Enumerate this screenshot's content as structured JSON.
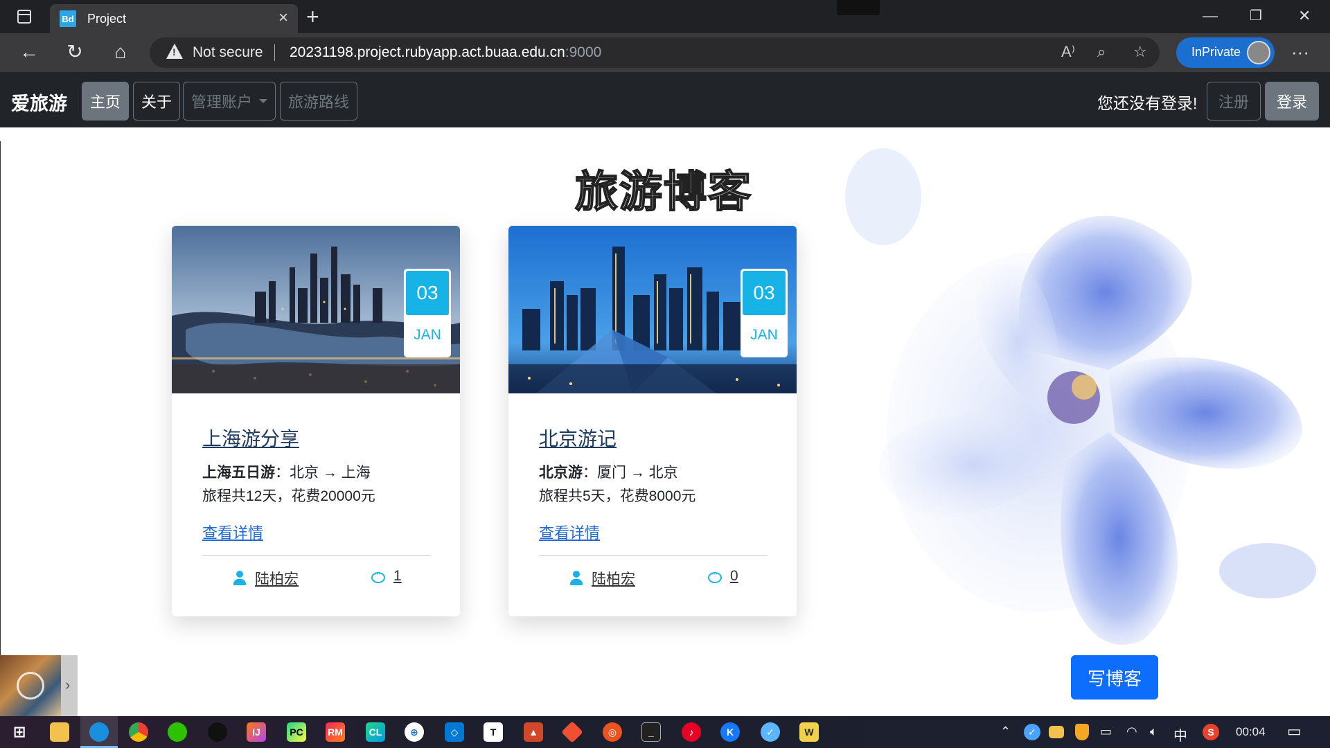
{
  "browser": {
    "tab_title": "Project",
    "tab_favicon": "Bd",
    "security_label": "Not secure",
    "url_host": "20231198.project.rubyapp.act.buaa.edu.cn",
    "url_port": ":9000",
    "inprivate_label": "InPrivate"
  },
  "navbar": {
    "brand": "爱旅游",
    "items": [
      {
        "label": "主页"
      },
      {
        "label": "关于"
      },
      {
        "label": "管理账户"
      },
      {
        "label": "旅游路线"
      }
    ],
    "login_message": "您还没有登录!",
    "register_label": "注册",
    "login_label": "登录"
  },
  "main": {
    "title": "旅游博客",
    "write_button": "写博客",
    "cards": [
      {
        "day": "03",
        "month": "JAN",
        "title": "上海游分享",
        "route_name": "上海五日游",
        "route_path": "北京 → 上海",
        "summary": "旅程共12天，花费20000元",
        "detail_link": "查看详情",
        "author": "陆柏宏",
        "comments": "1"
      },
      {
        "day": "03",
        "month": "JAN",
        "title": "北京游记",
        "route_name": "北京游",
        "route_path": "厦门 → 北京",
        "summary": "旅程共5天，花费8000元",
        "detail_link": "查看详情",
        "author": "陆柏宏",
        "comments": "0"
      }
    ]
  },
  "taskbar": {
    "clock": "00:04",
    "ime": "中"
  },
  "colors": {
    "accent": "#17b3e6",
    "primary_button": "#0d6efd",
    "navbar_bg": "#212529"
  }
}
